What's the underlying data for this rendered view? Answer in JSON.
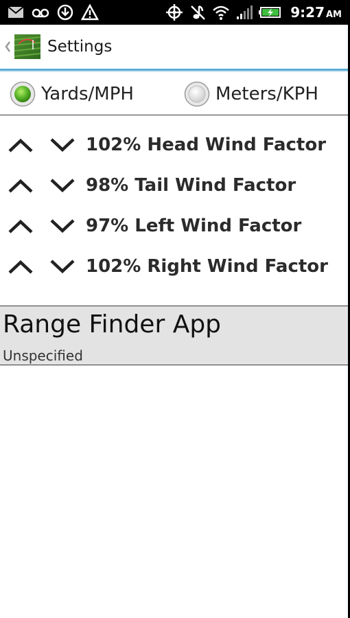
{
  "status_bar": {
    "icons_left": [
      "gmail-icon",
      "voicemail-icon",
      "download-icon",
      "warning-icon"
    ],
    "icons_right": [
      "gps-icon",
      "mute-icon",
      "wifi-icon",
      "signal-icon",
      "battery-icon"
    ],
    "time": "9:27",
    "ampm": "AM"
  },
  "title_bar": {
    "title": "Settings",
    "app_icon": "golf-course-icon"
  },
  "units": {
    "options": [
      {
        "label": "Yards/MPH",
        "selected": true
      },
      {
        "label": "Meters/KPH",
        "selected": false
      }
    ]
  },
  "wind_factors": [
    {
      "label": "102% Head Wind Factor"
    },
    {
      "label": "98% Tail Wind Factor"
    },
    {
      "label": "97% Left Wind Factor"
    },
    {
      "label": "102% Right Wind Factor"
    }
  ],
  "range_finder": {
    "title": "Range Finder App",
    "subtitle": "Unspecified"
  },
  "colors": {
    "accent": "#5aaed6",
    "selected_radio": "#5cb82a",
    "section_bg": "#e3e3e3"
  }
}
